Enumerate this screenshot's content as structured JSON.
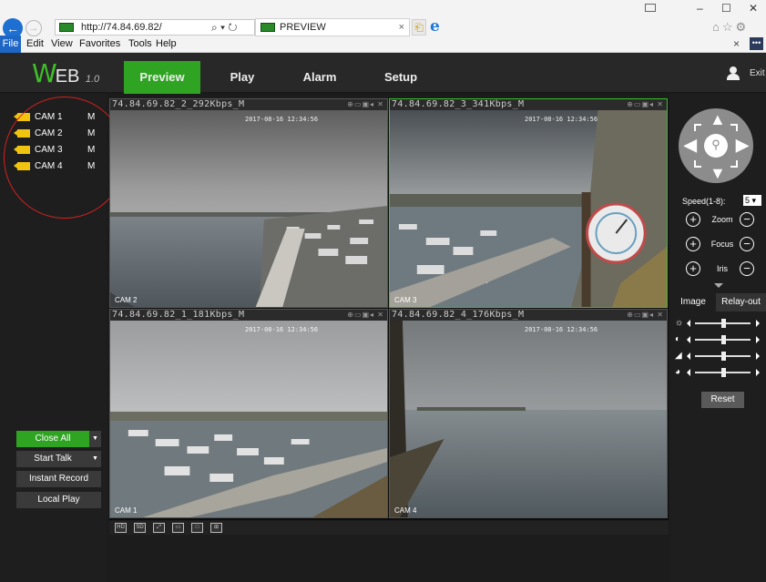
{
  "browser": {
    "address": "http://74.84.69.82/",
    "address_tools": "⌕ ▾ ↻",
    "tab_title": "PREVIEW",
    "tab_close": "×",
    "new_tab": "⎗",
    "ie_logo": "e",
    "window": {
      "minimize": "–",
      "maximize": "☐",
      "close": "✕"
    },
    "toolbar_icons": "⌂☆⚙",
    "bar_close": "×",
    "bar_more": "•••",
    "menu": [
      "File",
      "Edit",
      "View",
      "Favorites",
      "Tools",
      "Help"
    ]
  },
  "app": {
    "logo": {
      "w": "W",
      "rest": "EB",
      "version": "1.0"
    },
    "nav": [
      "Preview",
      "Play",
      "Alarm",
      "Setup"
    ],
    "active_nav": "Preview",
    "exit_label": "Exit",
    "accent_color": "#2fa422"
  },
  "cameras": [
    {
      "name": "CAM 1",
      "stream": "M"
    },
    {
      "name": "CAM 2",
      "stream": "M"
    },
    {
      "name": "CAM 3",
      "stream": "M"
    },
    {
      "name": "CAM 4",
      "stream": "M"
    }
  ],
  "left_buttons": {
    "close_all": "Close All",
    "start_talk": "Start Talk",
    "instant_record": "Instant Record",
    "local_play": "Local Play",
    "dropdown_arrow": "▼"
  },
  "panes": [
    {
      "title": "74.84.69.82_2_292Kbps_M",
      "cam_label": "CAM 2",
      "timestamp": "2017-08-16 12:34:56",
      "active": false
    },
    {
      "title": "74.84.69.82_3_341Kbps_M",
      "cam_label": "CAM 3",
      "timestamp": "2017-08-16 12:34:56",
      "active": true
    },
    {
      "title": "74.84.69.82_1_181Kbps_M",
      "cam_label": "CAM 1",
      "timestamp": "2017-08-16 12:34:56",
      "active": false
    },
    {
      "title": "74.84.69.82_4_176Kbps_M",
      "cam_label": "CAM 4",
      "timestamp": "2017-08-16 12:34:56",
      "active": false
    }
  ],
  "pane_icons": "⊕▭▣◂ ✕",
  "layout_buttons": [
    "HD",
    "SD",
    "⤢",
    "▭",
    "□",
    "⊞"
  ],
  "ptz": {
    "center_icon": "search-icon",
    "center_glyph": "⚲",
    "arrows": {
      "up": "▲",
      "down": "▼",
      "left": "◀",
      "right": "▶"
    },
    "speed_label": "Speed(1-8):",
    "speed_value": "5 ▾",
    "controls": [
      "Zoom",
      "Focus",
      "Iris"
    ],
    "plus_glyph": "+",
    "minus_glyph": "−"
  },
  "image_tabs": {
    "image": "Image",
    "relay": "Relay-out"
  },
  "sliders": [
    {
      "icon": "brightness-icon",
      "glyph": "☼",
      "value": 0.5
    },
    {
      "icon": "contrast-icon",
      "glyph": "◐",
      "value": 0.5
    },
    {
      "icon": "saturation-icon",
      "glyph": "◢",
      "value": 0.5
    },
    {
      "icon": "hue-icon",
      "glyph": "◕",
      "value": 0.5
    }
  ],
  "reset_label": "Reset"
}
